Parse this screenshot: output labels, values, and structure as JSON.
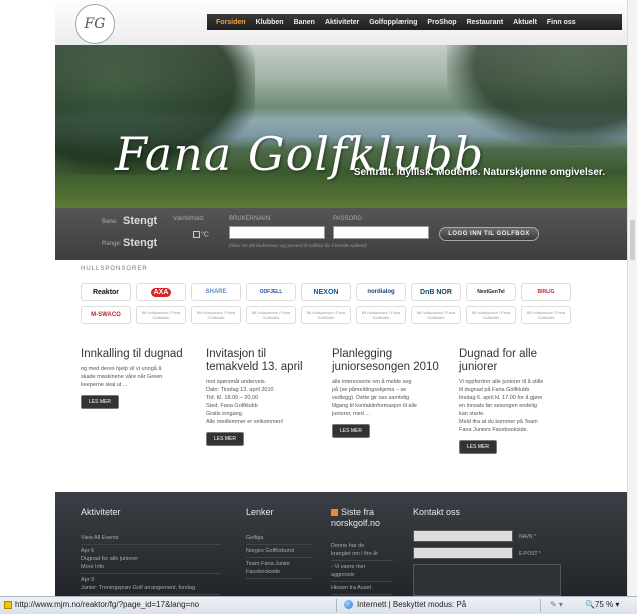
{
  "nav": [
    "Forsiden",
    "Klubben",
    "Banen",
    "Aktiviteter",
    "Golfopplæring",
    "ProShop",
    "Restaurant",
    "Aktuelt",
    "Finn oss"
  ],
  "logo": "FG",
  "hero": {
    "title": "Fana Golfklubb",
    "slogan": "Sentralt. Idyllisk. Moderne. Naturskjønne omgivelser."
  },
  "login": {
    "bane_label": "Bane:",
    "bane_value": "Stengt",
    "range_label": "Range:",
    "range_value": "Stengt",
    "weather_label": "Værforhold:",
    "degree": "°C",
    "user_label": "BRUKERNAVN",
    "pass_label": "PASSORD",
    "button": "LOGG INN TIL GOLFBOX",
    "note": "(Skriv inn ditt brukernavn og passord til Golfbox for å bestille spilletid)"
  },
  "sponsors": {
    "title": "HULLSPONSORER",
    "row1": [
      "Reaktor",
      "AXA",
      "SHARE",
      "ODFJELL",
      "NEXON",
      "nordialog",
      "DnB NOR",
      "NextGenTel",
      "BIRLIG"
    ],
    "row2_first": "M-SWACO",
    "placeholder": "Bli hullsponsor i Fana Golfklubb"
  },
  "news": [
    {
      "title": "Innkalling til dugnad",
      "lines": [
        "og med deres hjelp vil vi unngå å",
        "skade maskinene våre når Green",
        "keeperne skal ut ..."
      ],
      "button": "LES MER"
    },
    {
      "title": "Invitasjon til temakveld 13. april",
      "lines": [
        "mot spørsmål underveis.",
        "Dato:  Tirsdag 13. april 2010",
        "Tid:     Kl. 18.00 – 20.00",
        "Sted:  Fana Golfklubb",
        "Gratis inngang.",
        "Alle medlemmer er velkommen!"
      ],
      "button": "LES MER"
    },
    {
      "title": "Planlegging juniorsesongen 2010",
      "lines": [
        "alle interesserte om å melde seg",
        "på (se påmeldingsskjema – se",
        "vedlegg). Dette gir oss samtidig",
        "tilgang til kontaktinformasjon til alle",
        "juniorer, med ..."
      ],
      "button": "LES MER"
    },
    {
      "title": "Dugnad for alle juniorer",
      "lines": [
        "Vi oppfordrer alle juniorer til å stille",
        "til dugnad på Fana Golfklubb",
        "tirsdag 6. april kl. 17.00 for å gjøre",
        "en innsats før sesongen endelig",
        "kan starte.",
        "Meld ifra at du kommer på Team",
        "Fana Juniors Facebookside."
      ],
      "button": "LES MER"
    }
  ],
  "footer": {
    "aktiviteter_title": "Aktiviteter",
    "aktiviteter": [
      "View All Events",
      "Apr 6",
      "Dugnad for alle juniorer",
      "More Info",
      "Apr 9",
      "Junior: Treningsprøv Golf arrangement, forslag"
    ],
    "lenker_title": "Lenker",
    "lenker": [
      "Golfiga",
      "Norges Golfforbund",
      "Team Fana Junior",
      "Facebookside"
    ],
    "siste_title": "Siste fra norskgolf.no",
    "siste": [
      "Denne har de",
      "kranglet om i fire år",
      "- Vi vaere mer",
      "aggressiv",
      "Hiosen fra Asset"
    ],
    "kontakt_title": "Kontakt oss",
    "navn": "NAVN *",
    "epost": "E-POST *"
  },
  "status": {
    "url": "http://www.mjm.no/reaktor/fg/?page_id=17&lang=no",
    "zone": "Internett | Beskyttet modus: På",
    "zoom": "75 %"
  }
}
